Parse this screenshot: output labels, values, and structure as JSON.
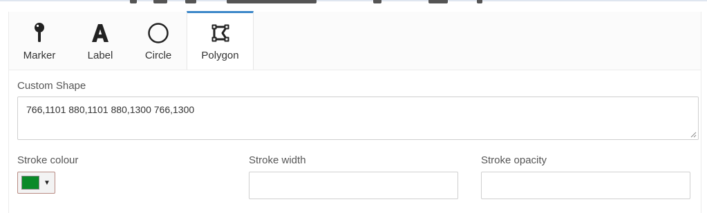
{
  "tabs": [
    {
      "label": "Marker",
      "icon": "map-pin-icon",
      "active": false
    },
    {
      "label": "Label",
      "icon": "letter-a-icon",
      "active": false
    },
    {
      "label": "Circle",
      "icon": "circle-icon",
      "active": false
    },
    {
      "label": "Polygon",
      "icon": "polygon-icon",
      "active": true
    }
  ],
  "custom_shape": {
    "label": "Custom Shape",
    "value": "766,1101 880,1101 880,1300 766,1300"
  },
  "stroke_colour": {
    "label": "Stroke colour",
    "color": "#0a8a28"
  },
  "stroke_width": {
    "label": "Stroke width",
    "value": ""
  },
  "stroke_opacity": {
    "label": "Stroke opacity",
    "value": ""
  },
  "accent_color": "#3a86c8"
}
